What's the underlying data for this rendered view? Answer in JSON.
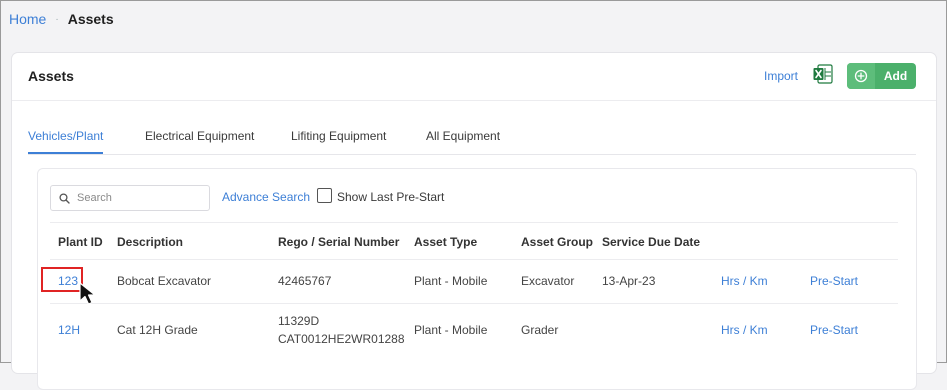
{
  "breadcrumb": {
    "home": "Home",
    "separator": "·",
    "current": "Assets"
  },
  "header": {
    "title": "Assets",
    "import_label": "Import",
    "excel_icon": "excel-icon",
    "add_label": "Add",
    "add_icon": "plus-circle-icon",
    "accent": "#4bb06b"
  },
  "tabs": [
    {
      "label": "Vehicles/Plant",
      "active": true
    },
    {
      "label": "Electrical Equipment"
    },
    {
      "label": "Lifiting Equipment"
    },
    {
      "label": "All Equipment"
    }
  ],
  "toolbar": {
    "search_placeholder": "Search",
    "advance_search": "Advance Search",
    "show_last_prestart": "Show Last Pre-Start"
  },
  "table": {
    "columns": [
      "Plant ID",
      "Description",
      "Rego / Serial Number",
      "Asset Type",
      "Asset Group",
      "Service Due Date"
    ],
    "rows": [
      {
        "plant_id": "123",
        "description": "Bobcat Excavator",
        "rego_line1": "42465767",
        "rego_line2": "",
        "asset_type": "Plant - Mobile",
        "asset_group": "Excavator",
        "service_due": "13-Apr-23",
        "hrs_km": "Hrs / Km",
        "prestart": "Pre-Start"
      },
      {
        "plant_id": "12H",
        "description": "Cat 12H Grade",
        "rego_line1": "11329D",
        "rego_line2": "CAT0012HE2WR01288",
        "asset_type": "Plant - Mobile",
        "asset_group": "Grader",
        "service_due": "",
        "hrs_km": "Hrs / Km",
        "prestart": "Pre-Start"
      }
    ]
  }
}
